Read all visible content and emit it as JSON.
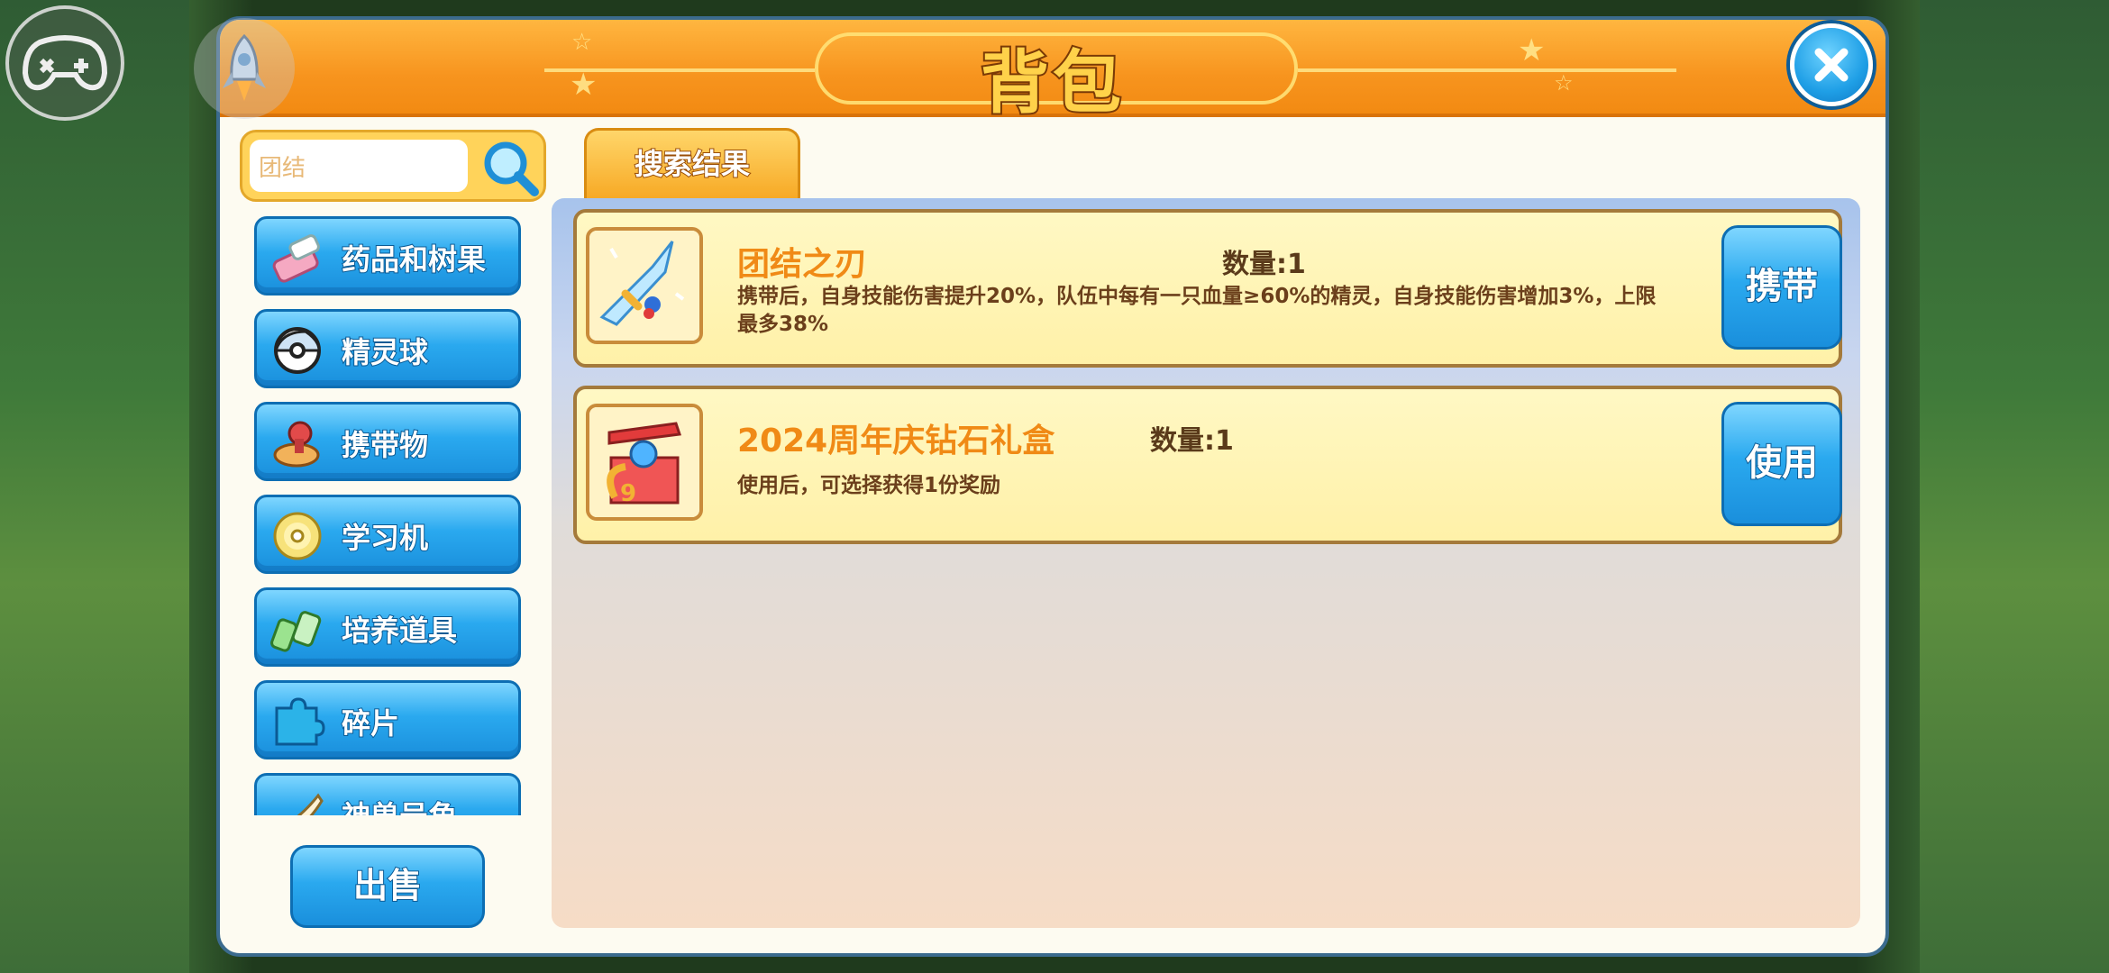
{
  "window": {
    "title": "背包"
  },
  "overlay": {
    "gamepad_icon": "gamepad-icon",
    "rocket_icon": "rocket-icon"
  },
  "search": {
    "value": "团结",
    "icon": "magnifier-icon"
  },
  "categories": [
    {
      "label": "药品和树果",
      "icon": "medicine-icon"
    },
    {
      "label": "精灵球",
      "icon": "pokeball-icon"
    },
    {
      "label": "携带物",
      "icon": "held-item-icon"
    },
    {
      "label": "学习机",
      "icon": "disc-icon"
    },
    {
      "label": "培养道具",
      "icon": "training-item-icon"
    },
    {
      "label": "碎片",
      "icon": "puzzle-icon"
    },
    {
      "label": "神兽号角",
      "icon": "horn-icon"
    }
  ],
  "sell_button": {
    "label": "出售"
  },
  "tabs": [
    {
      "label": "搜索结果",
      "active": true
    }
  ],
  "items": [
    {
      "name": "团结之刃",
      "quantity": "数量:1",
      "description": "携带后，自身技能伤害提升20%，队伍中每有一只血量≥60%的精灵，自身技能伤害增加3%，上限最多38%",
      "action": "携带",
      "icon": "blade-icon"
    },
    {
      "name": "2024周年庆钻石礼盒",
      "quantity": "数量:1",
      "description": "使用后，可选择获得1份奖励",
      "action": "使用",
      "icon": "gift-box-icon"
    }
  ],
  "colors": {
    "accent": "#f7941e",
    "button": "#2aa9ef",
    "item_name": "#f08a16"
  }
}
